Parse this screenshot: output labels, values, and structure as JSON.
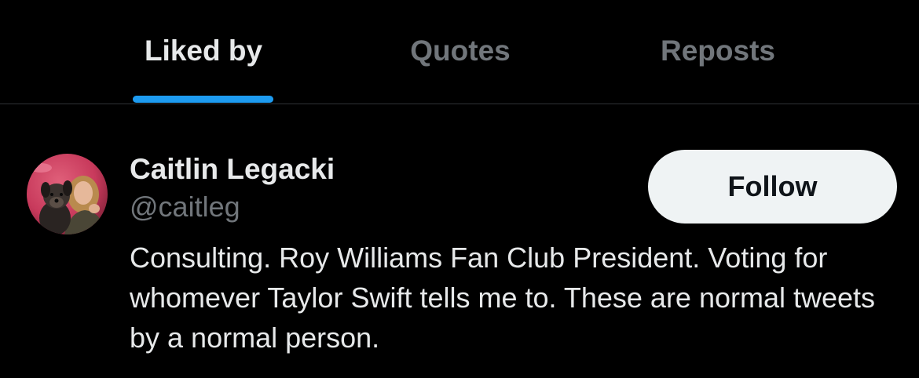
{
  "tabs": [
    {
      "label": "Liked by",
      "active": true
    },
    {
      "label": "Quotes",
      "active": false
    },
    {
      "label": "Reposts",
      "active": false
    }
  ],
  "colors": {
    "background": "#000000",
    "accent": "#1d9bf0",
    "primary_text": "#e7e9ea",
    "secondary_text": "#71767b",
    "divider": "#2f3336",
    "follow_button_bg": "#eff3f4"
  },
  "user": {
    "display_name": "Caitlin Legacki",
    "handle": "@caitleg",
    "follow_label": "Follow",
    "bio": "Consulting. Roy Williams Fan Club President. Voting for whomever Taylor Swift tells me to. These are normal tweets by a normal person.",
    "avatar_icon": "avatar-photo"
  }
}
